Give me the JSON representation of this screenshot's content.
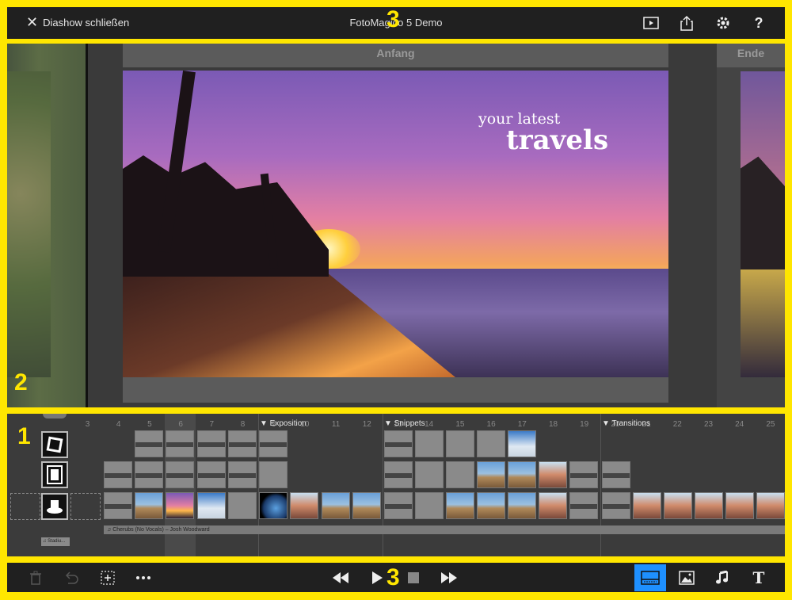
{
  "topbar": {
    "close_label": "Diashow schließen",
    "title": "FotoMagico 5 Demo",
    "icons": [
      "close-icon",
      "play-preview-icon",
      "share-icon",
      "gear-icon",
      "help-icon"
    ],
    "help_label": "?"
  },
  "stage": {
    "start_label": "Anfang",
    "end_label": "Ende",
    "slide_overlay_small": "your latest",
    "slide_overlay_big": "travels"
  },
  "timeline": {
    "column_numbers": [
      "3",
      "4",
      "5",
      "6",
      "7",
      "8",
      "9",
      "10",
      "11",
      "12",
      "13",
      "14",
      "15",
      "16",
      "17",
      "18",
      "19",
      "20",
      "21",
      "22",
      "23",
      "24",
      "25"
    ],
    "sections": [
      "▼ Exposition",
      "▼ Snippets",
      "▼ Transitions"
    ],
    "music_track_label": "♫ Cherubs (No Vocals) – Josh Woodward",
    "sidebar_music_chip": "♫ Stadiu..."
  },
  "bottombar": {
    "icons": [
      "trash-icon",
      "undo-icon",
      "add-slide-icon",
      "more-icon",
      "rewind-icon",
      "play-icon",
      "stop-icon",
      "fast-forward-icon",
      "timeline-view-icon",
      "image-icon",
      "music-icon",
      "text-icon"
    ],
    "text_tool_label": "T"
  },
  "annotations": [
    "3",
    "2",
    "1",
    "3"
  ],
  "colors": {
    "annotation": "#ffe600",
    "accent": "#1e90ff",
    "bar": "#202020"
  }
}
